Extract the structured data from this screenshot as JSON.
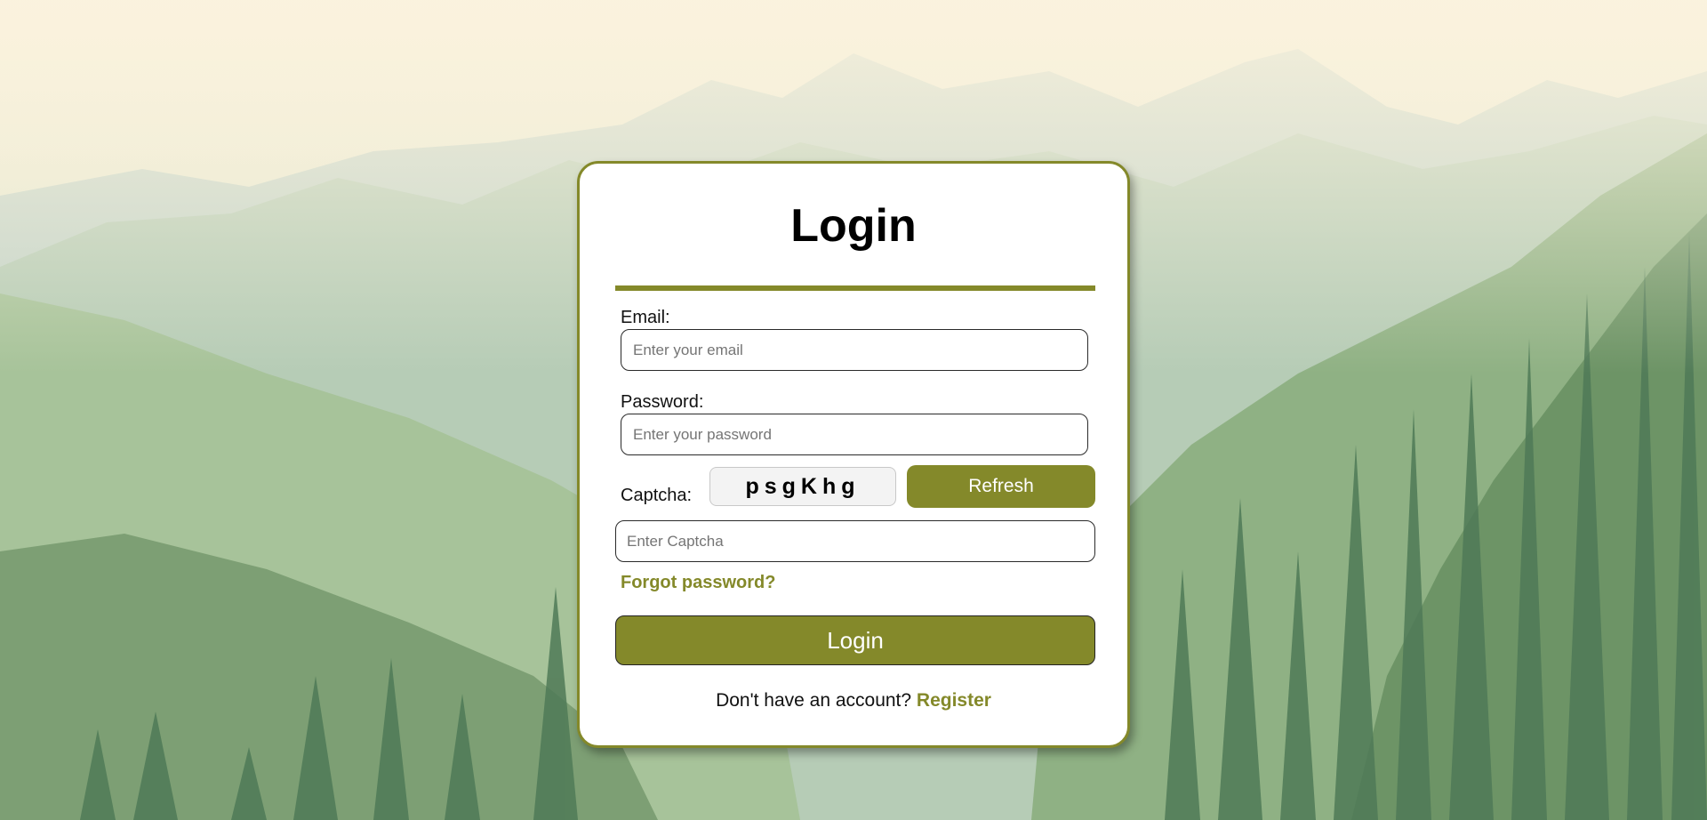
{
  "login_form": {
    "title": "Login",
    "email": {
      "label": "Email:",
      "value": "",
      "placeholder": "Enter your email"
    },
    "password": {
      "label": "Password:",
      "value": "",
      "placeholder": "Enter your password"
    },
    "captcha": {
      "label": "Captcha:",
      "code": "psgKhg",
      "refresh_label": "Refresh",
      "input_value": "",
      "input_placeholder": "Enter Captcha"
    },
    "forgot_password_label": "Forgot password?",
    "submit_label": "Login",
    "register_prompt": "Don't have an account?",
    "register_label": "Register"
  },
  "colors": {
    "accent": "#84892a",
    "card_background": "#ffffff",
    "captcha_background": "#f3f3f3"
  }
}
